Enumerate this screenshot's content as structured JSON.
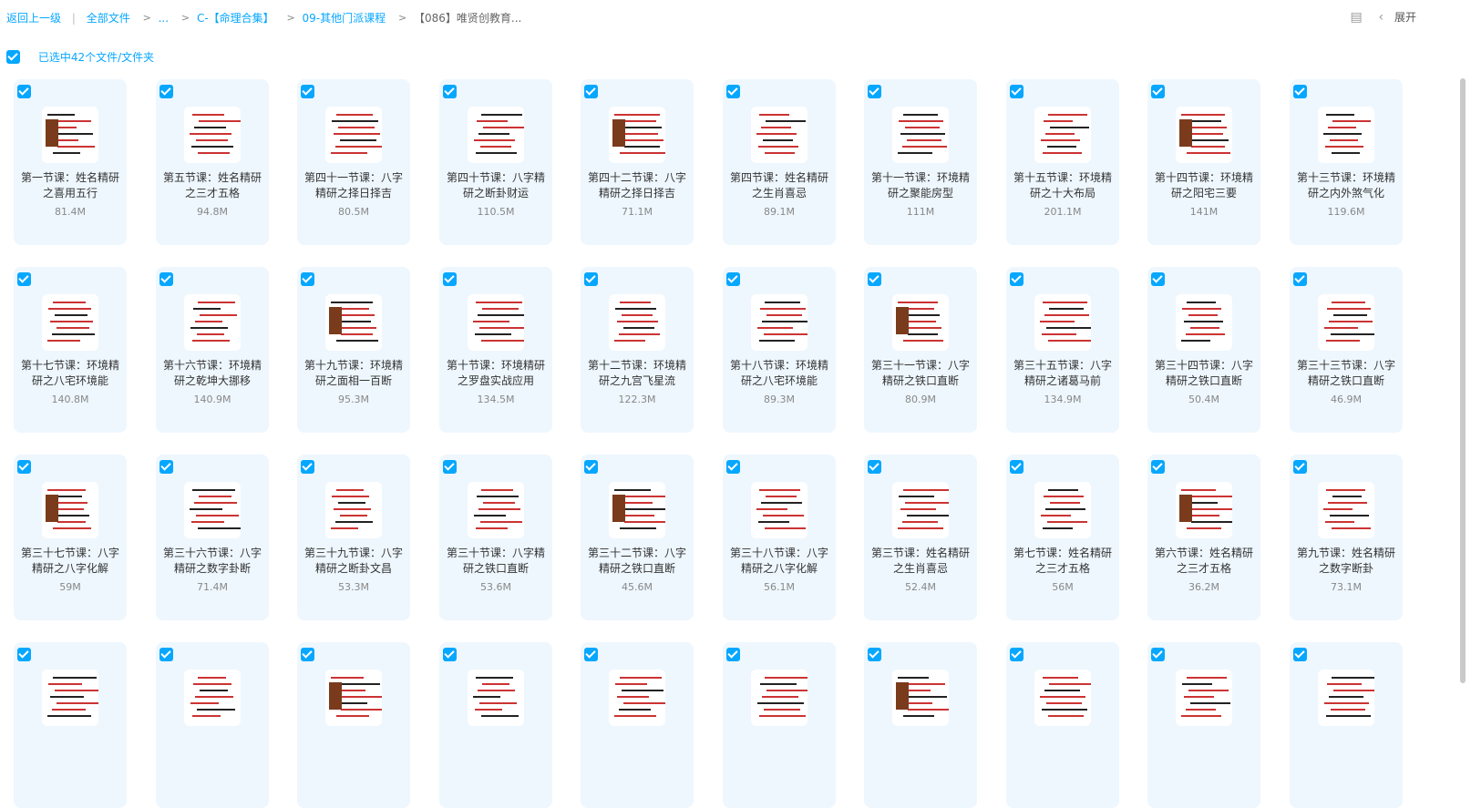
{
  "breadcrumb": {
    "back": "返回上一级",
    "all_files": "全部文件",
    "ellipsis": "...",
    "level1": "C-【命理合集】",
    "level2": "09-其他门派课程",
    "current": "【086】唯贤创教育..."
  },
  "toolbar": {
    "expand_label": "展开"
  },
  "selection": {
    "text": "已选中42个文件/文件夹"
  },
  "files": [
    {
      "name": "第一节课：姓名精研之喜用五行",
      "size": "81.4M"
    },
    {
      "name": "第五节课：姓名精研之三才五格",
      "size": "94.8M"
    },
    {
      "name": "第四十一节课：八字精研之择日择吉",
      "size": "80.5M"
    },
    {
      "name": "第四十节课：八字精研之断卦财运",
      "size": "110.5M"
    },
    {
      "name": "第四十二节课：八字精研之择日择吉",
      "size": "71.1M"
    },
    {
      "name": "第四节课：姓名精研之生肖喜忌",
      "size": "89.1M"
    },
    {
      "name": "第十一节课：环境精研之聚能房型",
      "size": "111M"
    },
    {
      "name": "第十五节课：环境精研之十大布局",
      "size": "201.1M"
    },
    {
      "name": "第十四节课：环境精研之阳宅三要",
      "size": "141M"
    },
    {
      "name": "第十三节课：环境精研之内外煞气化",
      "size": "119.6M"
    },
    {
      "name": "第十七节课：环境精研之八宅环境能",
      "size": "140.8M"
    },
    {
      "name": "第十六节课：环境精研之乾坤大挪移",
      "size": "140.9M"
    },
    {
      "name": "第十九节课：环境精研之面相一百断",
      "size": "95.3M"
    },
    {
      "name": "第十节课：环境精研之罗盘实战应用",
      "size": "134.5M"
    },
    {
      "name": "第十二节课：环境精研之九宫飞星流",
      "size": "122.3M"
    },
    {
      "name": "第十八节课：环境精研之八宅环境能",
      "size": "89.3M"
    },
    {
      "name": "第三十一节课：八字精研之铁口直断",
      "size": "80.9M"
    },
    {
      "name": "第三十五节课：八字精研之诸葛马前",
      "size": "134.9M"
    },
    {
      "name": "第三十四节课：八字精研之铁口直断",
      "size": "50.4M"
    },
    {
      "name": "第三十三节课：八字精研之铁口直断",
      "size": "46.9M"
    },
    {
      "name": "第三十七节课：八字精研之八字化解",
      "size": "59M"
    },
    {
      "name": "第三十六节课：八字精研之数字卦断",
      "size": "71.4M"
    },
    {
      "name": "第三十九节课：八字精研之断卦文昌",
      "size": "53.3M"
    },
    {
      "name": "第三十节课：八字精研之铁口直断",
      "size": "53.6M"
    },
    {
      "name": "第三十二节课：八字精研之铁口直断",
      "size": "45.6M"
    },
    {
      "name": "第三十八节课：八字精研之八字化解",
      "size": "56.1M"
    },
    {
      "name": "第三节课：姓名精研之生肖喜忌",
      "size": "52.4M"
    },
    {
      "name": "第七节课：姓名精研之三才五格",
      "size": "56M"
    },
    {
      "name": "第六节课：姓名精研之三才五格",
      "size": "36.2M"
    },
    {
      "name": "第九节课：姓名精研之数字断卦",
      "size": "73.1M"
    },
    {
      "name": "",
      "size": ""
    },
    {
      "name": "",
      "size": ""
    },
    {
      "name": "",
      "size": ""
    },
    {
      "name": "",
      "size": ""
    },
    {
      "name": "",
      "size": ""
    },
    {
      "name": "",
      "size": ""
    },
    {
      "name": "",
      "size": ""
    },
    {
      "name": "",
      "size": ""
    },
    {
      "name": "",
      "size": ""
    },
    {
      "name": "",
      "size": ""
    }
  ]
}
